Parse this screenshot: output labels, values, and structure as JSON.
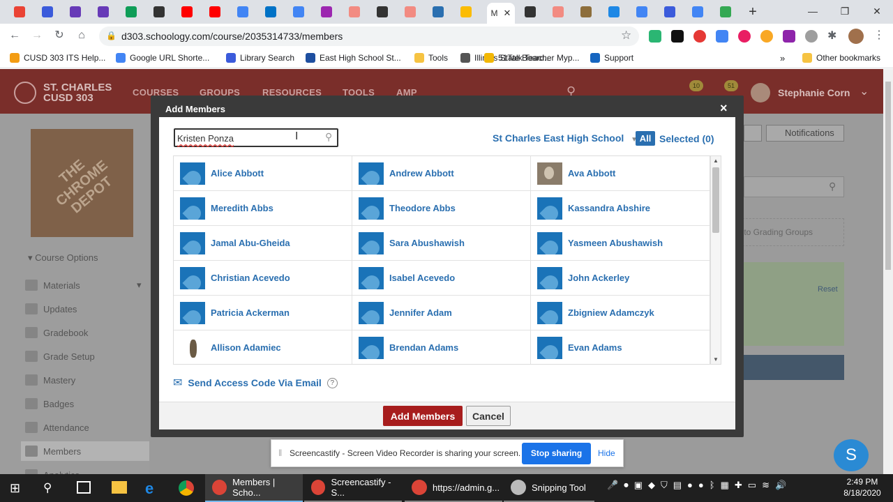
{
  "tabs": {
    "icons": [
      "gmail-icon",
      "docs-icon",
      "forms-icon",
      "forms-icon",
      "classroom-icon",
      "schoology-icon",
      "youtube-icon",
      "youtube-icon",
      "google-icon",
      "outlook-icon",
      "google-icon",
      "app-icon",
      "screencastify-icon",
      "schoology-icon",
      "screencastify-icon",
      "pear-deck-icon",
      "drive-icon",
      "schoology-icon",
      "screencastify-icon",
      "isbe-icon",
      "appstore-icon",
      "google-icon",
      "docs-icon",
      "google-icon",
      "maps-icon",
      "screencastify-icon"
    ],
    "active_label": "M",
    "new_tab": "+"
  },
  "window": {
    "minimize": "—",
    "restore": "❐",
    "close": "✕"
  },
  "address": {
    "url": "d303.schoology.com/course/2035314733/members"
  },
  "bookmarks": [
    {
      "label": "CUSD 303 ITS Help...",
      "color": "#f39c12"
    },
    {
      "label": "Google URL Shorte...",
      "color": "#4285f4"
    },
    {
      "label": "Library Search",
      "color": "#3b5bdb"
    },
    {
      "label": "East High School St...",
      "color": "#1e4fa0"
    },
    {
      "label": "Tools",
      "color": "#f6c342"
    },
    {
      "label": "Illinois State Board...",
      "color": "#555555"
    },
    {
      "label": "51Talk Teacher Myp...",
      "color": "#f2b705"
    },
    {
      "label": "Support",
      "color": "#1565c0"
    }
  ],
  "bookmarks_more": "»",
  "bookmarks_other": "Other bookmarks",
  "school": {
    "line1": "ST. CHARLES",
    "line2": "CUSD 303"
  },
  "nav": [
    "COURSES",
    "GROUPS",
    "RESOURCES",
    "TOOLS",
    "AMP"
  ],
  "user": {
    "name": "Stephanie Corn",
    "badge1": "10",
    "badge2": "51"
  },
  "course_options": "Course Options",
  "sidebar": [
    "Materials",
    "Updates",
    "Gradebook",
    "Grade Setup",
    "Mastery",
    "Badges",
    "Attendance",
    "Members",
    "Analytics"
  ],
  "right": {
    "notifications": "Notifications",
    "grading_groups": "into Grading Groups",
    "reset": "Reset"
  },
  "modal": {
    "title": "Add Members",
    "close": "×",
    "search_value": "Kristen Ponza",
    "school_filter": "St Charles East High School",
    "all_label": "All",
    "selected_label": "Selected (0)",
    "send_code": "Send Access Code Via Email",
    "help": "?",
    "add_button": "Add Members",
    "cancel_button": "Cancel"
  },
  "members": [
    {
      "name": "Alice Abbott",
      "avatar": "default"
    },
    {
      "name": "Andrew Abbott",
      "avatar": "default"
    },
    {
      "name": "Ava Abbott",
      "avatar": "photo"
    },
    {
      "name": "Meredith Abbs",
      "avatar": "default"
    },
    {
      "name": "Theodore Abbs",
      "avatar": "default"
    },
    {
      "name": "Kassandra Abshire",
      "avatar": "default"
    },
    {
      "name": "Jamal Abu-Gheida",
      "avatar": "default"
    },
    {
      "name": "Sara Abushawish",
      "avatar": "default"
    },
    {
      "name": "Yasmeen Abushawish",
      "avatar": "default"
    },
    {
      "name": "Christian Acevedo",
      "avatar": "default"
    },
    {
      "name": "Isabel Acevedo",
      "avatar": "default"
    },
    {
      "name": "John Ackerley",
      "avatar": "default"
    },
    {
      "name": "Patricia Ackerman",
      "avatar": "default"
    },
    {
      "name": "Jennifer Adam",
      "avatar": "default"
    },
    {
      "name": "Zbigniew Adamczyk",
      "avatar": "default"
    },
    {
      "name": "Allison Adamiec",
      "avatar": "photo2"
    },
    {
      "name": "Brendan Adams",
      "avatar": "default"
    },
    {
      "name": "Evan Adams",
      "avatar": "default"
    }
  ],
  "share_bar": {
    "text": "Screencastify - Screen Video Recorder is sharing your screen.",
    "stop": "Stop sharing",
    "hide": "Hide"
  },
  "help_bubble": "S",
  "taskbar": {
    "apps": [
      "Members | Scho...",
      "Screencastify - S...",
      "https://admin.g...",
      "Snipping Tool"
    ],
    "time": "2:49 PM",
    "date": "8/18/2020"
  },
  "colors": {
    "header": "#7a2e2a",
    "brand_red": "#a71d1d",
    "link_blue": "#2a6fb0",
    "avatar_blue": "#1a73b8",
    "stop_blue": "#1a73e8"
  }
}
